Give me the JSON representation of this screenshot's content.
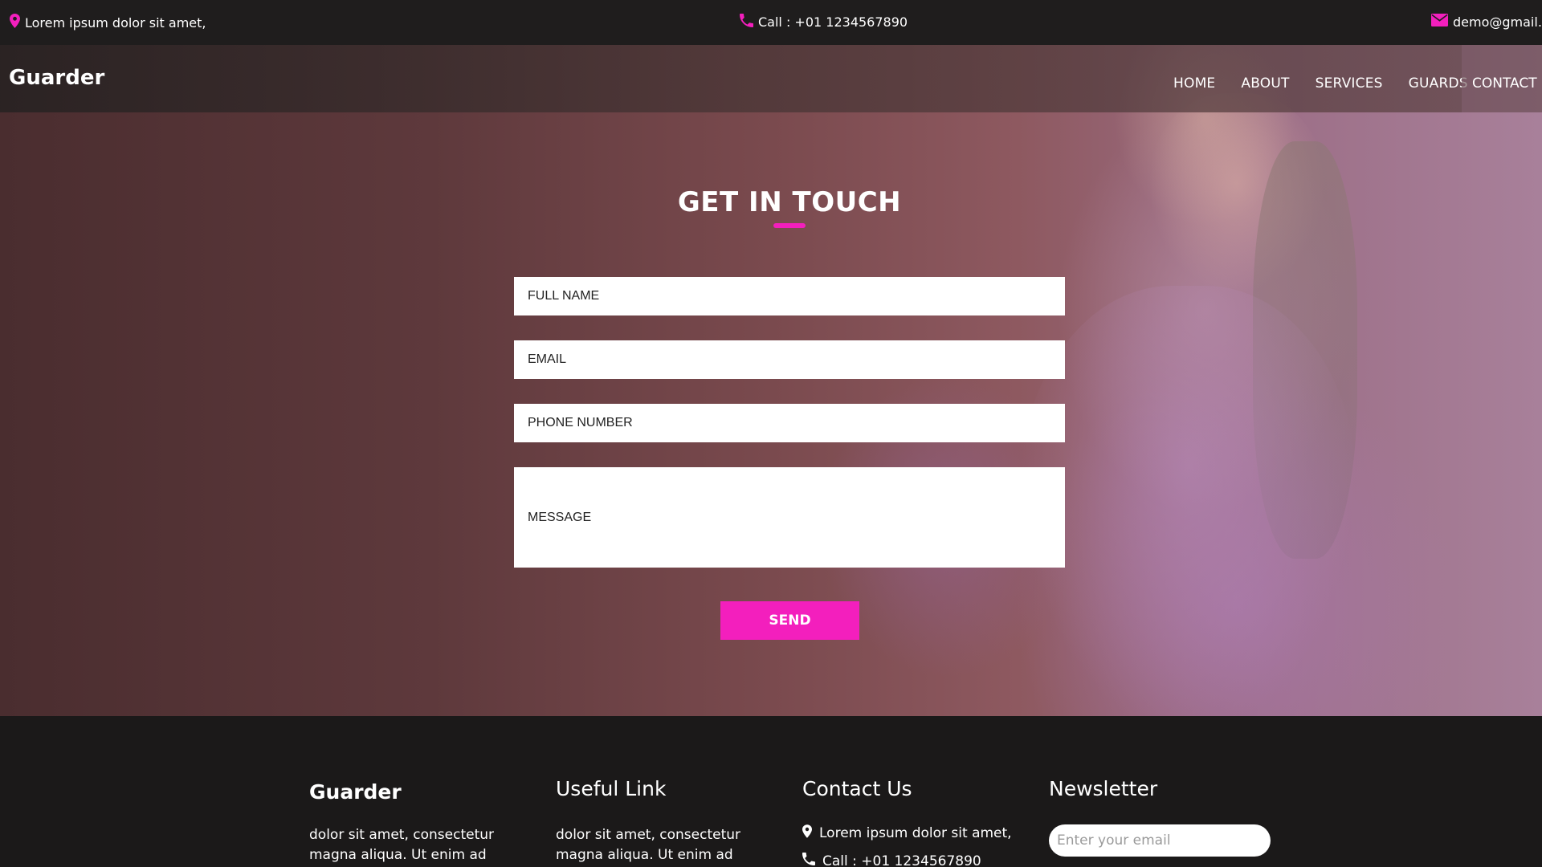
{
  "topbar": {
    "address": "Lorem ipsum dolor sit amet,",
    "phone": "Call : +01 1234567890",
    "email": "demo@gmail.com"
  },
  "navbar": {
    "brand": "Guarder",
    "items": [
      "HOME",
      "ABOUT",
      "SERVICES",
      "GUARDS",
      "CONTACT US"
    ]
  },
  "form": {
    "title": "GET IN TOUCH",
    "full_name_placeholder": "FULL NAME",
    "email_placeholder": "EMAIL",
    "phone_placeholder": "PHONE NUMBER",
    "message_placeholder": "MESSAGE",
    "send_label": "SEND"
  },
  "footer": {
    "brand": "Guarder",
    "brand_text": "dolor sit amet, consectetur magna aliqua. Ut enim ad",
    "useful_link_title": "Useful Link",
    "useful_link_text": "dolor sit amet, consectetur magna aliqua. Ut enim ad",
    "contact_title": "Contact Us",
    "contact_address": "Lorem ipsum dolor sit amet,",
    "contact_phone": "Call : +01 1234567890",
    "newsletter_title": "Newsletter",
    "newsletter_placeholder": "Enter your email"
  },
  "colors": {
    "accent": "#f31fbd",
    "dark_bg": "#1b1919"
  },
  "icons": {
    "location": "map-pin-icon",
    "phone": "phone-icon",
    "email": "envelope-icon"
  }
}
